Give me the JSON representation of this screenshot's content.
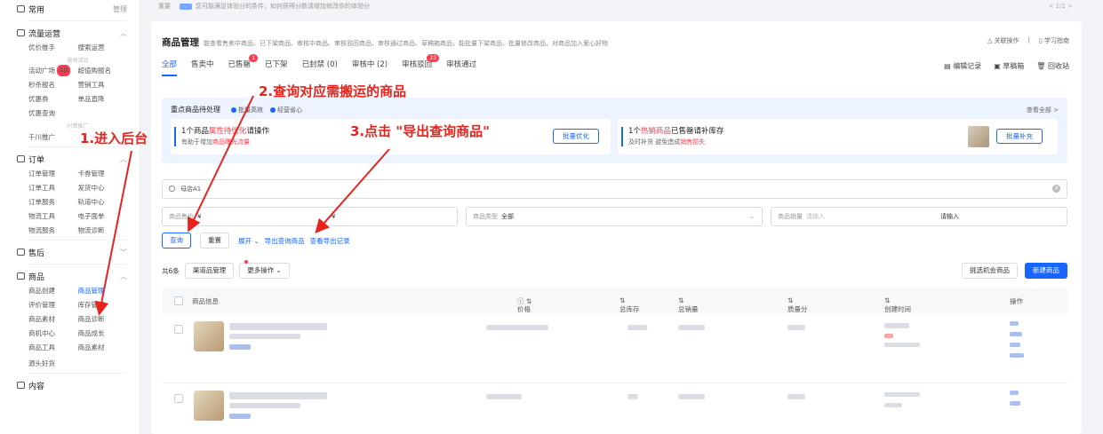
{
  "sidebar": {
    "common": {
      "label": "常用",
      "right": "管理"
    },
    "traffic": {
      "label": "流量运营",
      "items_a": [
        "优价推手",
        "搜索运营"
      ],
      "group_label": "营销活动",
      "items_b": [
        "活动广场",
        "超值购报名",
        "秒杀报名",
        "营销工具",
        "优惠券",
        "单品直降",
        "优惠查询"
      ],
      "activity_badge": "AB",
      "group_label_2": "付费推广",
      "qianchuan": "千川推广"
    },
    "orders": {
      "label": "订单",
      "items": [
        "订单管理",
        "卡券管理",
        "订单工具",
        "发货中心",
        "订单服务",
        "轨道中心",
        "物流工具",
        "电子面单",
        "物流服务",
        "物流诊断"
      ]
    },
    "aftersale": {
      "label": "售后"
    },
    "goods": {
      "label": "商品",
      "items": [
        "商品创建",
        "商品管理",
        "评价管理",
        "库存管理",
        "商品素材",
        "商品诊断",
        "商机中心",
        "商品成长",
        "商品工具",
        "商品素材"
      ],
      "extra": "源头好货"
    },
    "content": {
      "label": "内容"
    }
  },
  "topstrip": {
    "text": "重要",
    "notice": "您可能满足体验分的条件，如何获得分数请增加修改你的体验分",
    "pager": "< 1/2 >"
  },
  "header": {
    "title": "商品管理",
    "desc": "能查看售卖中商品、已下架商品、审核中商品、审核驳回商品、审核通过商品、草稿箱商品，能批量下架商品、批量修改商品，对商品加入爱心好物",
    "links": [
      "关联操作",
      "学习指南"
    ]
  },
  "tabs": [
    {
      "label": "全部",
      "active": true
    },
    {
      "label": "售卖中"
    },
    {
      "label": "已售罄",
      "badge": "1"
    },
    {
      "label": "已下架"
    },
    {
      "label": "已封禁 (0)"
    },
    {
      "label": "审核中 (2)"
    },
    {
      "label": "审核驳回",
      "badge": "23"
    },
    {
      "label": "审核通过"
    }
  ],
  "tab_tools": [
    "编辑记录",
    "草稿箱",
    "回收站"
  ],
  "panel": {
    "title": "重点商品待处理",
    "chips": [
      "批量高效",
      "经营省心"
    ],
    "view_all": "查看全部 >",
    "card1": {
      "l1_a": "1个商品",
      "l1_b": "属性待优化",
      "l1_c": "请操作",
      "l2_a": "有助于增加",
      "l2_b": "商品曝光流量",
      "button": "批量优化"
    },
    "card2": {
      "l1_a": "1个",
      "l1_b": "热销商品",
      "l1_c": "已售罄请补库存",
      "l2_a": "及时补货 避免造成",
      "l2_b": "销售损失",
      "button": "批量补充"
    }
  },
  "search": {
    "value": "母店A1"
  },
  "filters": {
    "price_label": "商品售价",
    "price_from": "¥",
    "price_to": "¥",
    "type_label": "商品类型",
    "type_value": "全部",
    "sales_label": "商品销量",
    "sales_from": "请输入",
    "sales_to": "请输入"
  },
  "actions": {
    "query": "查询",
    "reset": "重置",
    "expand": "展开",
    "export": "导出查询商品",
    "export_log": "查看导出记录"
  },
  "table_bar": {
    "count": "共6条",
    "channel": "渠道品管理",
    "more": "更多操作",
    "pick": "挑选机会商品",
    "create": "新建商品"
  },
  "columns": [
    "商品信息",
    "价格",
    "总库存",
    "总销量",
    "质量分",
    "创建时间",
    "操作"
  ],
  "annotations": {
    "step1": "1.进入后台",
    "step2": "2.查询对应需搬运的商品",
    "step3": "3.点击 \"导出查询商品\""
  }
}
